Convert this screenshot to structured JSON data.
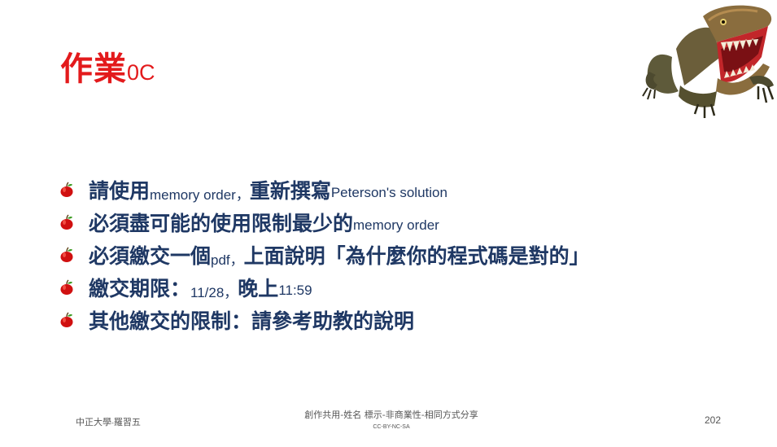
{
  "title": {
    "main": "作業",
    "suffix": "0C"
  },
  "bullets": [
    {
      "parts": [
        {
          "text": "請使用",
          "size": "big"
        },
        {
          "text": "memory order，",
          "size": "small"
        },
        {
          "text": "重新撰寫",
          "size": "big"
        },
        {
          "text": "Peterson's solution",
          "size": "small"
        }
      ]
    },
    {
      "parts": [
        {
          "text": "必須盡可能的使用限制最少的",
          "size": "big"
        },
        {
          "text": "memory order",
          "size": "small"
        }
      ]
    },
    {
      "parts": [
        {
          "text": "必須繳交一個",
          "size": "big"
        },
        {
          "text": "pdf，",
          "size": "small"
        },
        {
          "text": "上面說明「為什麼你的程式碼是對的」",
          "size": "big"
        }
      ]
    },
    {
      "parts": [
        {
          "text": "繳交期限：",
          "size": "big"
        },
        {
          "text": "11/28，",
          "size": "small"
        },
        {
          "text": "晚上",
          "size": "big"
        },
        {
          "text": "11:59",
          "size": "small"
        }
      ]
    },
    {
      "parts": [
        {
          "text": "其他繳交的限制：請參考助教的說明",
          "size": "big"
        }
      ]
    }
  ],
  "footer": {
    "left_main": "中正大學",
    "left_sep": "-",
    "left_name": "羅習五",
    "license_line": "創作共用-姓名 標示-非商業性-相同方式分享",
    "license_code": "CC-BY-NC-SA",
    "page_number": "202"
  },
  "colors": {
    "title": "#e31a1c",
    "text": "#1f3864",
    "bullet_icon": "red-apple"
  },
  "icons": {
    "bullet": "apple-icon",
    "decoration": "dinosaur-image"
  }
}
